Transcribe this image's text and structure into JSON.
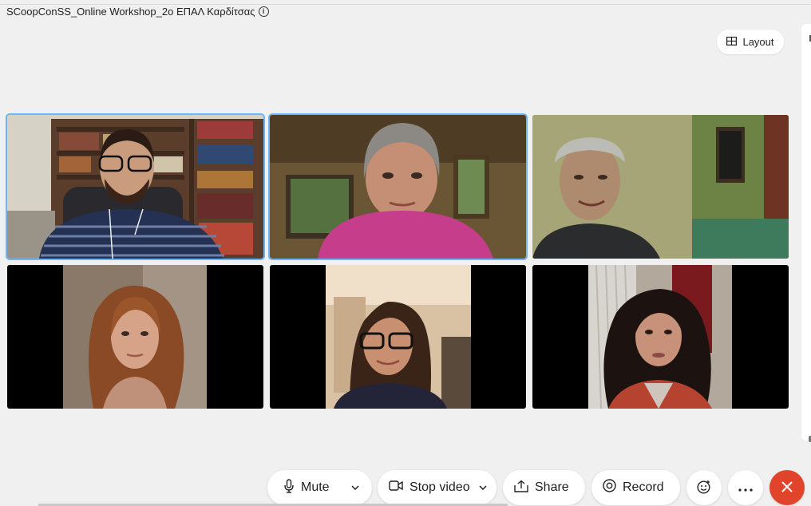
{
  "meeting": {
    "title": "SCoopConSS_Online Workshop_2o ΕΠΑΛ Καρδίτσας",
    "info_icon": "info-icon"
  },
  "layout_button": {
    "label": "Layout",
    "icon": "grid-icon"
  },
  "participants": [
    {
      "speaking": true,
      "background": "#c9c3b4"
    },
    {
      "speaking": true,
      "background": "#6b5a3c"
    },
    {
      "speaking": false,
      "background": "#6d7a55"
    },
    {
      "speaking": false,
      "background": "#000000"
    },
    {
      "speaking": false,
      "background": "#000000"
    },
    {
      "speaking": false,
      "background": "#000000"
    }
  ],
  "toolbar": {
    "mute": {
      "label": "Mute",
      "icon": "microphone-icon"
    },
    "stop_video": {
      "label": "Stop video",
      "icon": "video-camera-icon"
    },
    "share": {
      "label": "Share",
      "icon": "share-icon"
    },
    "record": {
      "label": "Record",
      "icon": "record-icon"
    },
    "reactions": {
      "icon": "emoji-icon"
    },
    "more": {
      "icon": "more-icon"
    },
    "end": {
      "icon": "close-icon",
      "color": "#e0452c"
    }
  },
  "colors": {
    "speaking_outline": "#6fb4f5",
    "background": "#f0f0f0",
    "end_button": "#e0452c"
  }
}
